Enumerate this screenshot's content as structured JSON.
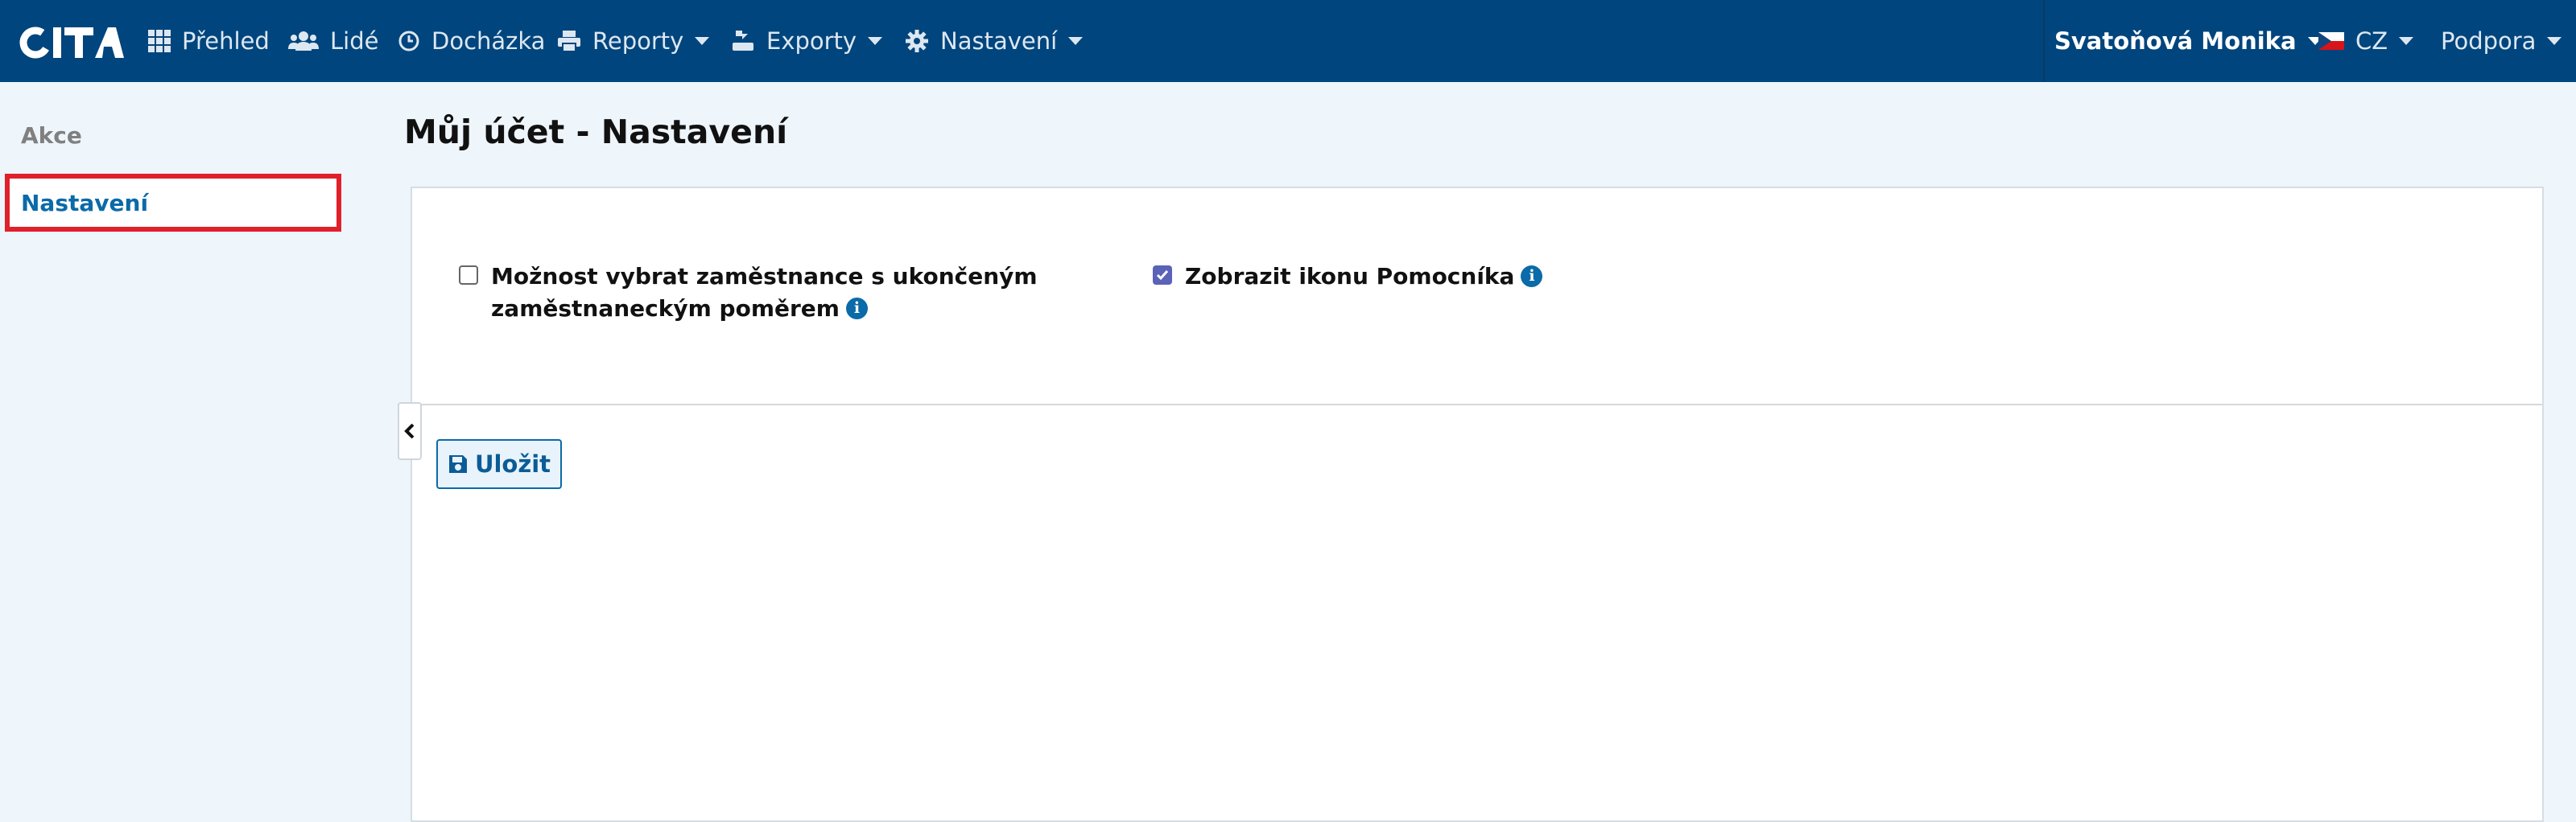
{
  "colors": {
    "navbar": "#00457d",
    "accent": "#0b6aa8",
    "highlight": "#e0202a",
    "checked": "#5a63b8"
  },
  "nav": {
    "logo": "CITA",
    "items": [
      {
        "label": "Přehled",
        "icon": "grid-icon"
      },
      {
        "label": "Lidé",
        "icon": "users-icon"
      },
      {
        "label": "Docházka",
        "icon": "clock-icon"
      },
      {
        "label": "Reporty",
        "icon": "printer-icon",
        "dropdown": true
      },
      {
        "label": "Exporty",
        "icon": "export-icon",
        "dropdown": true
      },
      {
        "label": "Nastavení",
        "icon": "gear-icon",
        "dropdown": true
      }
    ],
    "user": "Svatoňová Monika",
    "language": "CZ",
    "support": "Podpora"
  },
  "sidebar": {
    "items": [
      {
        "label": "Akce",
        "active": false
      },
      {
        "label": "Nastavení",
        "active": true
      }
    ]
  },
  "page": {
    "title": "Můj účet - Nastavení"
  },
  "settings": {
    "options": [
      {
        "line1": "Možnost vybrat zaměstnance s ukončeným",
        "line2": "zaměstnaneckým poměrem",
        "checked": false
      },
      {
        "line1": "Zobrazit ikonu Pomocníka",
        "checked": true
      }
    ],
    "save_label": "Uložit"
  }
}
